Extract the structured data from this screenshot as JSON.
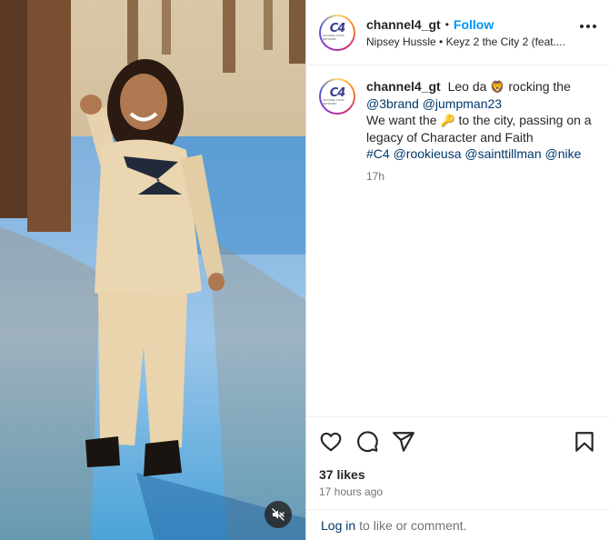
{
  "post": {
    "username": "channel4_gt",
    "follow_label": "Follow",
    "separator": "•",
    "audio": "Nipsey Hussle • Keyz 2 the City 2 (feat....",
    "avatar_logo_text": "C4",
    "avatar_logo_sub": "CHANNEL FOUR NETWORK"
  },
  "caption": {
    "username": "channel4_gt",
    "part1": "Leo da",
    "emoji_lion": "🦁",
    "part2": "rocking the",
    "mention1": "@3brand",
    "mention2": "@jumpman23",
    "part3": "We want the",
    "emoji_key": "🔑",
    "part4": "to the city, passing on a legacy of Character and Faith",
    "hashtag": "#C4",
    "mention3": "@rookieusa",
    "mention4": "@sainttillman",
    "mention5": "@nike",
    "time": "17h"
  },
  "stats": {
    "likes": "37 likes",
    "posted": "17 hours ago"
  },
  "footer": {
    "login_link": "Log in",
    "login_text": "to like or comment."
  },
  "icons": {
    "like": "heart-icon",
    "comment": "comment-icon",
    "share": "share-icon",
    "save": "bookmark-icon",
    "more": "more-options-icon",
    "mute": "audio-muted-icon"
  }
}
